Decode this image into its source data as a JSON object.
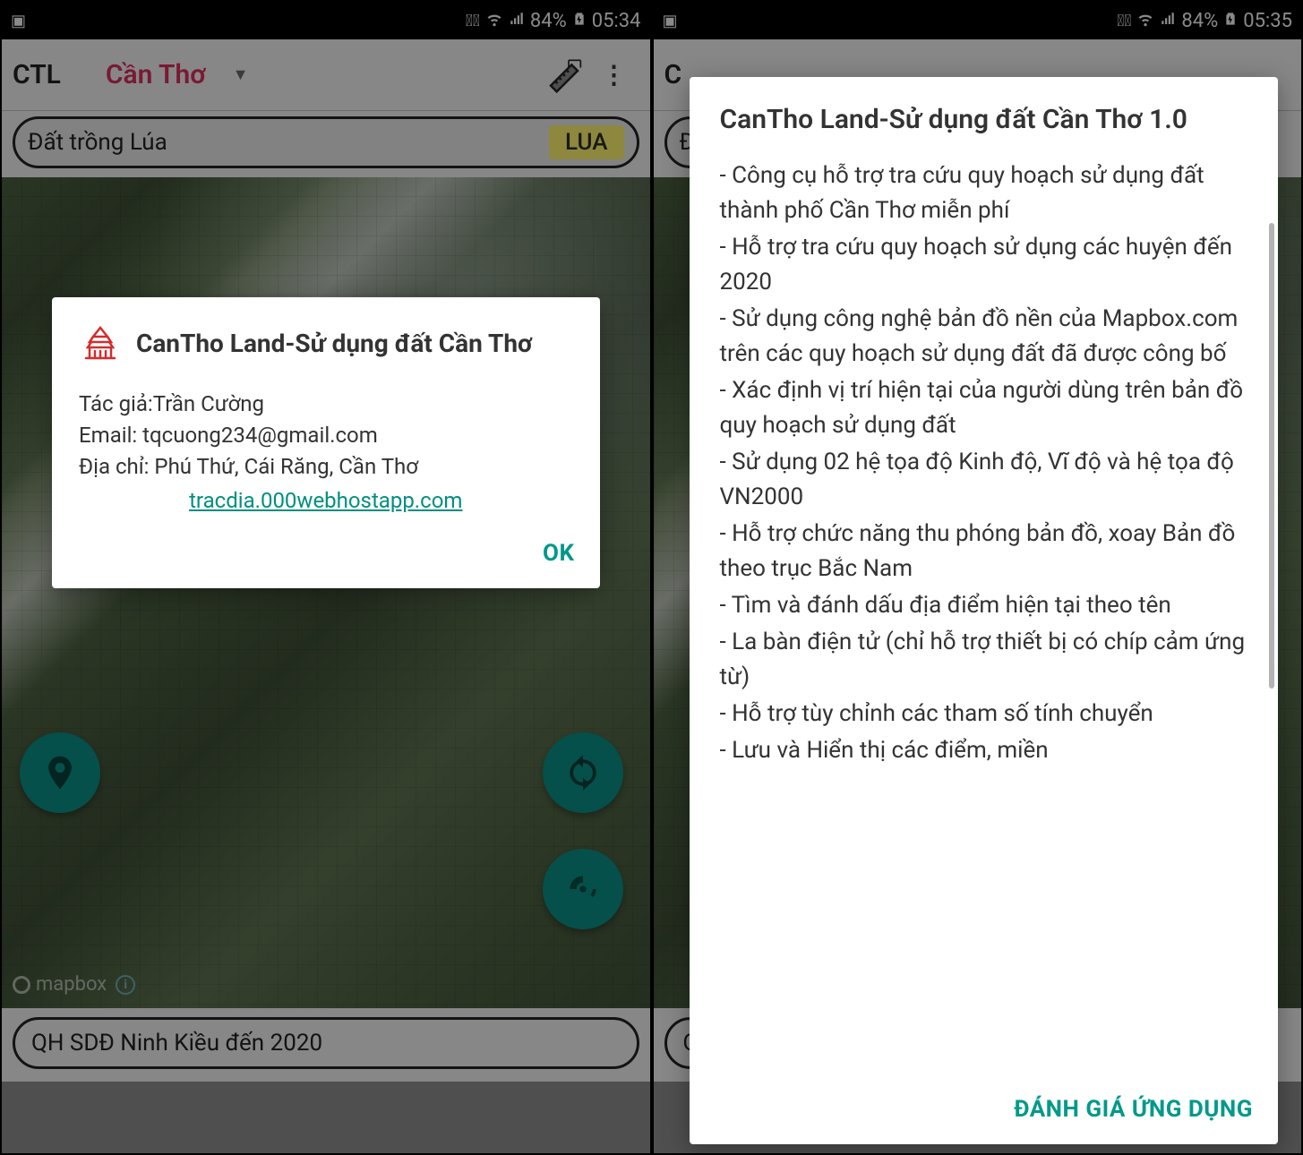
{
  "screen_left": {
    "status": {
      "battery": "84%",
      "time": "05:34"
    },
    "appbar": {
      "logo": "CTL",
      "spinner_label": "Cần Thơ"
    },
    "search": {
      "text": "Đất trồng Lúa",
      "badge": "LUA"
    },
    "bottom": {
      "text": "QH SDĐ Ninh Kiều đến 2020"
    },
    "map_credit": "mapbox",
    "dialog": {
      "title": "CanTho Land-Sử dụng đất Cần Thơ",
      "author_line": "Tác giả:Trần Cường",
      "email_line": "Email: tqcuong234@gmail.com",
      "address_line": "Địa chỉ: Phú Thứ, Cái Răng, Cần Thơ",
      "link": "tracdia.000webhostapp.com",
      "ok": "OK"
    }
  },
  "screen_right": {
    "status": {
      "battery": "84%",
      "time": "05:35"
    },
    "appbar": {
      "logo_partial": "C"
    },
    "search_partial": "Đấ",
    "bottom_partial": "Q",
    "dialog": {
      "title": "CanTho Land-Sử dụng đất Cần Thơ 1.0",
      "features": [
        "- Công cụ hỗ trợ tra cứu quy hoạch sử dụng đất thành phố Cần Thơ miễn phí",
        "- Hỗ trợ tra cứu quy hoạch sử dụng các huyện đến 2020",
        "- Sử dụng công nghệ bản đồ nền của Mapbox.com trên các quy hoạch sử dụng đất đã được công bố",
        "- Xác định vị trí hiện tại của người dùng trên bản đồ quy hoạch sử dụng đất",
        "- Sử dụng 02 hệ tọa độ Kinh độ, Vĩ độ và hệ tọa độ VN2000",
        "- Hỗ trợ chức năng thu phóng bản đồ, xoay Bản đồ theo trục Bắc Nam",
        "- Tìm và đánh dấu địa điểm hiện tại theo tên",
        "- La bàn điện tử (chỉ hỗ trợ thiết bị có chíp cảm ứng từ)",
        "- Hỗ trợ tùy chỉnh các tham số tính chuyển",
        "- Lưu và Hiển thị các điểm, miền"
      ],
      "action": "ĐÁNH GIÁ ỨNG DỤNG"
    }
  }
}
